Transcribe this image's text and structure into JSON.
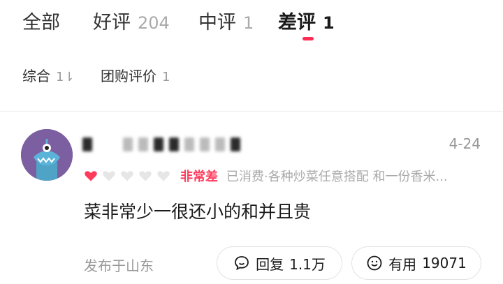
{
  "tabs": [
    {
      "label": "全部",
      "count": ""
    },
    {
      "label": "好评",
      "count": "204"
    },
    {
      "label": "中评",
      "count": "1"
    },
    {
      "label": "差评",
      "count": "1"
    }
  ],
  "active_tab_index": 3,
  "subfilters": [
    {
      "label": "综合",
      "count": "1⇂"
    },
    {
      "label": "团购评价",
      "count": "1"
    }
  ],
  "review": {
    "date": "4-24",
    "rating": {
      "filled_hearts": 1,
      "total_hearts": 5,
      "label": "非常差",
      "detail": "已消费·各种炒菜任意搭配 和一份香米..."
    },
    "comment": "菜非常少一很还小的和并且贵",
    "location": "发布于山东",
    "reply_button": {
      "label": "回复",
      "count": "1.1万"
    },
    "useful_button": {
      "label": "有用",
      "count": "19071"
    }
  },
  "colors": {
    "accent": "#ff2d55",
    "rating_text": "#ff3b5c",
    "avatar_bg": "#7b5fa0",
    "muted_text": "#999999"
  }
}
